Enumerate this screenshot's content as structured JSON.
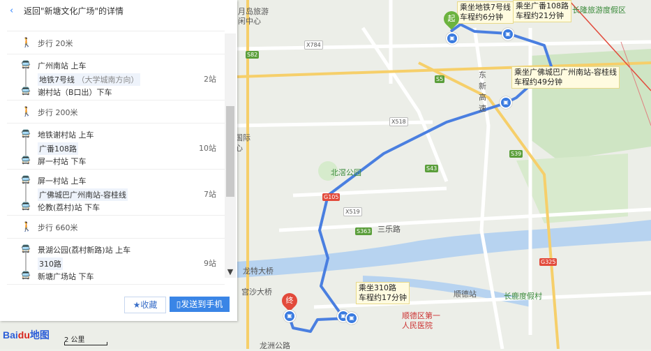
{
  "header": {
    "back_icon": "chevron-left-icon",
    "title": "返回\"新塘文化广场\"的详情"
  },
  "steps": [
    {
      "type": "walk",
      "text": "步行 20米"
    },
    {
      "type": "ride",
      "on": "广州南站 上车",
      "line": "地铁7号线",
      "line_dir": "（大学城南方向）",
      "count": "2站",
      "off": "谢村站（B口出）下车"
    },
    {
      "type": "walk",
      "text": "步行 200米"
    },
    {
      "type": "ride",
      "on": "地铁谢村站 上车",
      "line": "广番108路",
      "line_dir": "",
      "count": "10站",
      "off": "屏一村站 下车"
    },
    {
      "type": "ride",
      "on": "屏一村站 上车",
      "line": "广佛城巴广州南站-容桂线",
      "line_dir": "",
      "count": "7站",
      "off": "伦教(荔村)站 下车"
    },
    {
      "type": "walk",
      "text": "步行 660米"
    },
    {
      "type": "ride",
      "on": "景湖公园(荔村新路)站 上车",
      "line": "310路",
      "line_dir": "",
      "count": "9站",
      "off": "新塘广场站 下车"
    }
  ],
  "buttons": {
    "favorite": "收藏",
    "send": "发送到手机"
  },
  "map": {
    "labels": [
      {
        "text": "国际",
        "cls": ""
      },
      {
        "text": "心",
        "cls": ""
      },
      {
        "text": "北滘公园",
        "cls": "green"
      },
      {
        "text": "三乐路",
        "cls": ""
      },
      {
        "text": "龙特大桥",
        "cls": ""
      },
      {
        "text": "宫沙大桥",
        "cls": ""
      },
      {
        "text": "龙洲公路",
        "cls": ""
      },
      {
        "text": "顺德站",
        "cls": ""
      },
      {
        "text": "长鹿度假村",
        "cls": "green"
      },
      {
        "text": "顺德区第一",
        "cls": "red"
      },
      {
        "text": "人民医院",
        "cls": "red"
      },
      {
        "text": "长隆旅游度假区",
        "cls": "green"
      },
      {
        "text": "东新高速",
        "cls": ""
      },
      {
        "text": "月岛旅游",
        "cls": ""
      },
      {
        "text": "闲中心",
        "cls": ""
      }
    ],
    "road_tags": [
      {
        "text": "S82",
        "kind": "s"
      },
      {
        "text": "X784",
        "kind": "x"
      },
      {
        "text": "S5",
        "kind": "s"
      },
      {
        "text": "X518",
        "kind": "x"
      },
      {
        "text": "S43",
        "kind": "s"
      },
      {
        "text": "S39",
        "kind": "s"
      },
      {
        "text": "G105",
        "kind": "g"
      },
      {
        "text": "X519",
        "kind": "x"
      },
      {
        "text": "S363",
        "kind": "s"
      },
      {
        "text": "G325",
        "kind": "g"
      }
    ],
    "bubbles": [
      {
        "l1": "乘坐地铁7号线",
        "l2": "车程约6分钟"
      },
      {
        "l1": "乘坐广番108路",
        "l2": "车程约21分钟"
      },
      {
        "l1": "乘坐广佛城巴广州南站-容桂线",
        "l2": "车程约49分钟"
      },
      {
        "l1": "乘坐310路",
        "l2": "车程约17分钟"
      }
    ],
    "start_pin": "起",
    "end_pin": "终",
    "route_color": "#4a7fe0"
  },
  "logo": {
    "text": "Bai",
    "paw": "du",
    "suffix": "地图"
  },
  "scale": "2 公里"
}
